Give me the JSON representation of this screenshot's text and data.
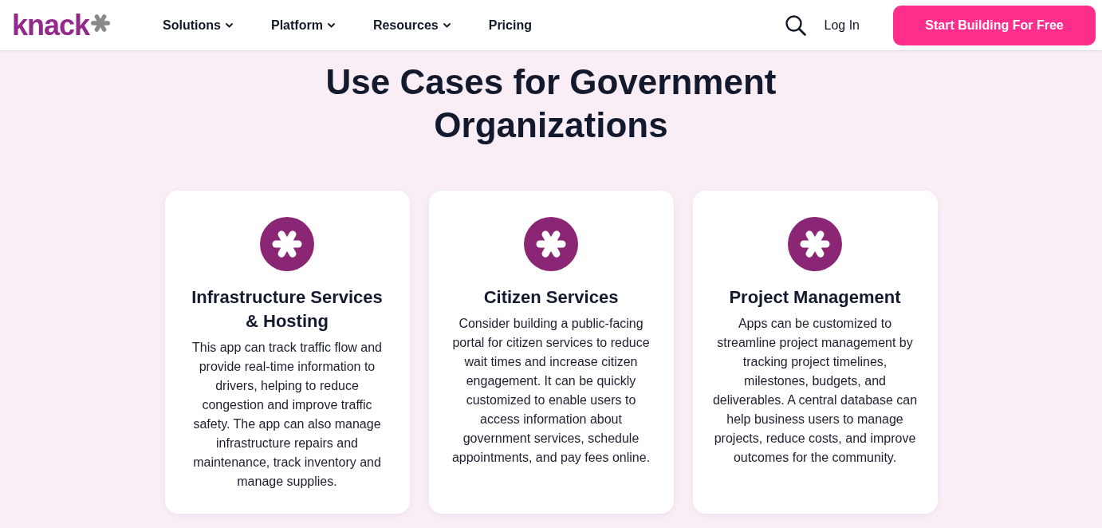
{
  "header": {
    "logo": {
      "text": "knack"
    },
    "nav": [
      {
        "label": "Solutions",
        "dropdown": true
      },
      {
        "label": "Platform",
        "dropdown": true
      },
      {
        "label": "Resources",
        "dropdown": true
      },
      {
        "label": "Pricing",
        "dropdown": false
      }
    ],
    "login": "Log In",
    "cta": "Start Building For Free"
  },
  "section": {
    "title": "Use Cases for Government Organizations",
    "cards": [
      {
        "title": "Infrastructure Services & Hosting",
        "body": "This app can track traffic flow and provide real-time information to drivers, helping to reduce congestion and improve traffic safety. The app can also manage infrastructure repairs and maintenance, track inventory and manage supplies."
      },
      {
        "title": "Citizen Services",
        "body": "Consider building a public-facing portal for citizen services to reduce wait times and increase citizen engagement. It can be quickly customized to enable users to access information about government services, schedule appointments, and pay fees online."
      },
      {
        "title": "Project Management",
        "body": "Apps can be customized to streamline project management by tracking project timelines, milestones, budgets, and deliverables. A central database can help business users to manage projects, reduce costs, and improve outcomes for the community."
      }
    ]
  }
}
